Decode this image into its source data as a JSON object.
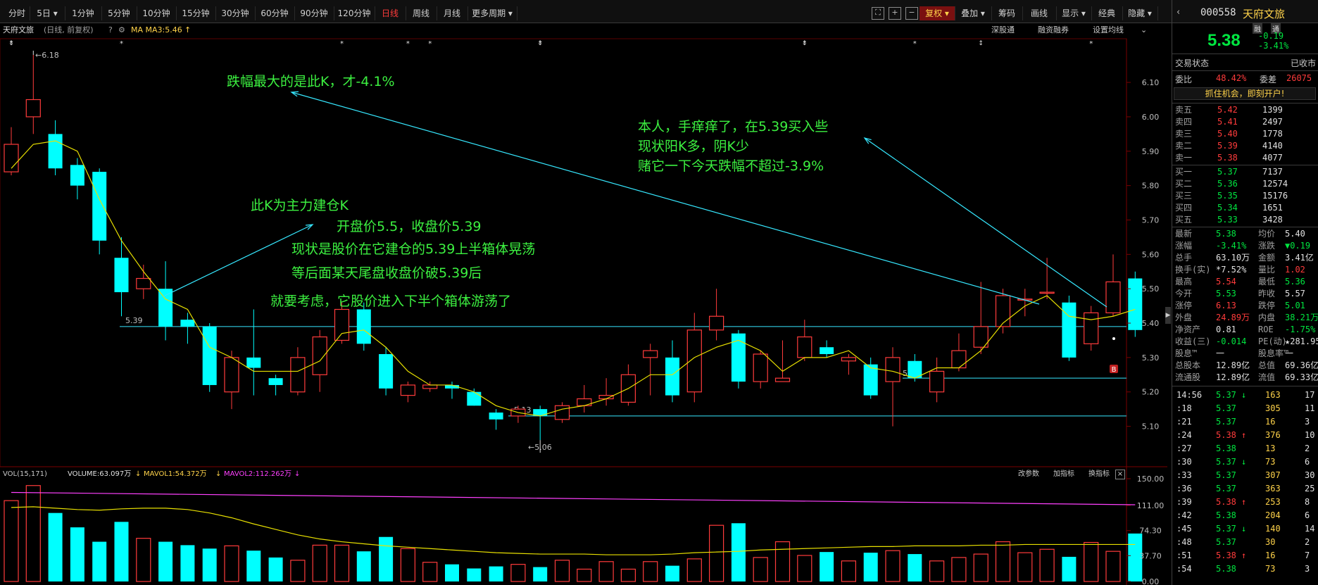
{
  "toolbar": {
    "periods": [
      "分时",
      "5日",
      "1分钟",
      "5分钟",
      "10分钟",
      "15分钟",
      "30分钟",
      "60分钟",
      "90分钟",
      "120分钟",
      "日线",
      "周线",
      "月线",
      "更多周期"
    ],
    "active_period": "日线",
    "right_buttons": [
      "复权",
      "叠加",
      "筹码",
      "画线",
      "显示",
      "经典",
      "隐藏"
    ]
  },
  "subbar": {
    "stock_name": "天府文旅",
    "mode": "(日线, 前复权)",
    "ma_label": "MA  MA3:5.46",
    "links": [
      "深股通",
      "融资融券",
      "设置均线"
    ]
  },
  "annotations": {
    "a1": "跌幅最大的是此K，才-4.1%",
    "a2": "本人，手痒痒了，在5.39买入些",
    "a3": "现状阳K多，阴K少",
    "a4": "赌它一下今天跌幅不超过-3.9%",
    "a5": "此K为主力建仓K",
    "a6": "开盘价5.5，收盘价5.39",
    "a7": "现状是股价在它建仓的5.39上半箱体晃荡",
    "a8": "等后面某天尾盘收盘价破5.39后",
    "a9": "就要考虑，它股价进入下半个箱体游荡了"
  },
  "price_labels": {
    "high": "6.18",
    "low": "5.06",
    "line539": "5.39",
    "line513": "5.13",
    "line524": "5.24"
  },
  "price_axis": [
    "6.10",
    "6.00",
    "5.90",
    "5.80",
    "5.70",
    "5.60",
    "5.50",
    "5.40",
    "5.30",
    "5.20",
    "5.10"
  ],
  "vol": {
    "header_prefix": "VOL(15,171)",
    "volume": "VOLUME:63.097万",
    "mavol1": "MAVOL1:54.372万",
    "mavol2": "MAVOL2:112.262万",
    "links": [
      "改参数",
      "加指标",
      "换指标"
    ],
    "axis": [
      "150.00",
      "111.00",
      "74.30",
      "37.70",
      "0.00"
    ]
  },
  "chart_data": {
    "type": "candlestick",
    "candles": [
      {
        "o": 5.84,
        "c": 5.92,
        "h": 5.97,
        "l": 5.83
      },
      {
        "o": 6.0,
        "c": 6.05,
        "h": 6.18,
        "l": 5.95
      },
      {
        "o": 5.95,
        "c": 5.85,
        "h": 5.99,
        "l": 5.83
      },
      {
        "o": 5.86,
        "c": 5.8,
        "h": 5.88,
        "l": 5.76
      },
      {
        "o": 5.84,
        "c": 5.64,
        "h": 5.85,
        "l": 5.6
      },
      {
        "o": 5.59,
        "c": 5.49,
        "h": 5.65,
        "l": 5.42
      },
      {
        "o": 5.5,
        "c": 5.53,
        "h": 5.57,
        "l": 5.47
      },
      {
        "o": 5.5,
        "c": 5.39,
        "h": 5.58,
        "l": 5.35
      },
      {
        "o": 5.41,
        "c": 5.39,
        "h": 5.43,
        "l": 5.34
      },
      {
        "o": 5.39,
        "c": 5.22,
        "h": 5.4,
        "l": 5.2
      },
      {
        "o": 5.2,
        "c": 5.3,
        "h": 5.32,
        "l": 5.15
      },
      {
        "o": 5.3,
        "c": 5.27,
        "h": 5.44,
        "l": 5.19
      },
      {
        "o": 5.24,
        "c": 5.22,
        "h": 5.25,
        "l": 5.19
      },
      {
        "o": 5.2,
        "c": 5.3,
        "h": 5.33,
        "l": 5.19
      },
      {
        "o": 5.25,
        "c": 5.36,
        "h": 5.38,
        "l": 5.2
      },
      {
        "o": 5.35,
        "c": 5.44,
        "h": 5.46,
        "l": 5.34
      },
      {
        "o": 5.44,
        "c": 5.34,
        "h": 5.46,
        "l": 5.32
      },
      {
        "o": 5.31,
        "c": 5.21,
        "h": 5.33,
        "l": 5.19
      },
      {
        "o": 5.19,
        "c": 5.22,
        "h": 5.23,
        "l": 5.17
      },
      {
        "o": 5.21,
        "c": 5.22,
        "h": 5.23,
        "l": 5.2
      },
      {
        "o": 5.22,
        "c": 5.21,
        "h": 5.23,
        "l": 5.18
      },
      {
        "o": 5.2,
        "c": 5.16,
        "h": 5.21,
        "l": 5.16
      },
      {
        "o": 5.14,
        "c": 5.12,
        "h": 5.15,
        "l": 5.09
      },
      {
        "o": 5.13,
        "c": 5.15,
        "h": 5.16,
        "l": 5.11
      },
      {
        "o": 5.15,
        "c": 5.13,
        "h": 5.16,
        "l": 5.06
      },
      {
        "o": 5.12,
        "c": 5.16,
        "h": 5.17,
        "l": 5.11
      },
      {
        "o": 5.16,
        "c": 5.18,
        "h": 5.22,
        "l": 5.14
      },
      {
        "o": 5.18,
        "c": 5.19,
        "h": 5.24,
        "l": 5.16
      },
      {
        "o": 5.17,
        "c": 5.25,
        "h": 5.28,
        "l": 5.16
      },
      {
        "o": 5.3,
        "c": 5.32,
        "h": 5.34,
        "l": 5.19
      },
      {
        "o": 5.3,
        "c": 5.19,
        "h": 5.35,
        "l": 5.17
      },
      {
        "o": 5.2,
        "c": 5.38,
        "h": 5.43,
        "l": 5.17
      },
      {
        "o": 5.38,
        "c": 5.42,
        "h": 5.5,
        "l": 5.35
      },
      {
        "o": 5.37,
        "c": 5.23,
        "h": 5.38,
        "l": 5.21
      },
      {
        "o": 5.23,
        "c": 5.31,
        "h": 5.32,
        "l": 5.21
      },
      {
        "o": 5.23,
        "c": 5.24,
        "h": 5.35,
        "l": 5.23
      },
      {
        "o": 5.3,
        "c": 5.36,
        "h": 5.41,
        "l": 5.29
      },
      {
        "o": 5.33,
        "c": 5.31,
        "h": 5.35,
        "l": 5.3
      },
      {
        "o": 5.29,
        "c": 5.3,
        "h": 5.31,
        "l": 5.25
      },
      {
        "o": 5.28,
        "c": 5.19,
        "h": 5.3,
        "l": 5.18
      },
      {
        "o": 5.23,
        "c": 5.3,
        "h": 5.33,
        "l": 5.1
      },
      {
        "o": 5.29,
        "c": 5.24,
        "h": 5.31,
        "l": 5.23
      },
      {
        "o": 5.2,
        "c": 5.26,
        "h": 5.3,
        "l": 5.17
      },
      {
        "o": 5.27,
        "c": 5.32,
        "h": 5.37,
        "l": 5.26
      },
      {
        "o": 5.33,
        "c": 5.39,
        "h": 5.52,
        "l": 5.31
      },
      {
        "o": 5.39,
        "c": 5.48,
        "h": 5.5,
        "l": 5.37
      },
      {
        "o": 5.47,
        "c": 5.47,
        "h": 5.5,
        "l": 5.42
      },
      {
        "o": 5.49,
        "c": 5.49,
        "h": 5.59,
        "l": 5.47
      },
      {
        "o": 5.46,
        "c": 5.3,
        "h": 5.48,
        "l": 5.29
      },
      {
        "o": 5.34,
        "c": 5.43,
        "h": 5.45,
        "l": 5.32
      },
      {
        "o": 5.43,
        "c": 5.52,
        "h": 5.6,
        "l": 5.42
      },
      {
        "o": 5.53,
        "c": 5.38,
        "h": 5.55,
        "l": 5.36
      }
    ],
    "ma3": [
      5.85,
      5.92,
      5.93,
      5.9,
      5.76,
      5.64,
      5.55,
      5.47,
      5.44,
      5.33,
      5.3,
      5.26,
      5.26,
      5.26,
      5.29,
      5.37,
      5.38,
      5.33,
      5.26,
      5.22,
      5.22,
      5.2,
      5.16,
      5.14,
      5.13,
      5.15,
      5.16,
      5.18,
      5.21,
      5.25,
      5.25,
      5.3,
      5.33,
      5.35,
      5.32,
      5.26,
      5.3,
      5.3,
      5.32,
      5.27,
      5.26,
      5.24,
      5.27,
      5.27,
      5.32,
      5.4,
      5.45,
      5.48,
      5.42,
      5.41,
      5.42,
      5.44
    ],
    "volume": [
      118,
      140,
      100,
      79,
      58,
      87,
      63,
      58,
      53,
      48,
      52,
      45,
      35,
      31,
      53,
      53,
      44,
      65,
      48,
      28,
      25,
      19,
      22,
      25,
      21,
      31,
      18,
      29,
      18,
      29,
      23,
      33,
      82,
      85,
      35,
      58,
      38,
      43,
      30,
      42,
      45,
      40,
      30,
      35,
      40,
      58,
      42,
      47,
      36,
      57,
      44,
      70
    ],
    "mavol1": [
      108,
      109,
      107,
      105,
      104,
      106,
      107,
      107,
      105,
      100,
      93,
      84,
      76,
      68,
      62,
      58,
      55,
      52,
      50,
      48,
      46,
      44,
      42,
      41,
      40,
      40,
      40,
      39,
      39,
      39,
      40,
      42,
      43,
      44,
      46,
      47,
      48,
      49,
      50,
      51,
      51,
      52,
      52,
      52,
      53,
      53,
      54,
      54,
      54,
      54,
      54,
      54
    ],
    "mavol2_range": [
      130,
      112
    ],
    "yrange": [
      5.05,
      6.18
    ],
    "vol_range": [
      0,
      150
    ]
  },
  "quote": {
    "code": "000558",
    "name": "天府文旅",
    "badges": [
      "融",
      "通"
    ],
    "price": "5.38",
    "change": "-0.19",
    "change_pct": "-3.41%",
    "status_label": "交易状态",
    "status_value": "已收市",
    "weibi_label": "委比",
    "weibi": "48.42%",
    "weicha_label": "委差",
    "weicha": "26075",
    "promo": "抓住机会，即刻开户!",
    "asks": [
      [
        "卖五",
        "5.42",
        "1399"
      ],
      [
        "卖四",
        "5.41",
        "2497"
      ],
      [
        "卖三",
        "5.40",
        "1778"
      ],
      [
        "卖二",
        "5.39",
        "4140"
      ],
      [
        "卖一",
        "5.38",
        "4077"
      ]
    ],
    "bids": [
      [
        "买一",
        "5.37",
        "7137"
      ],
      [
        "买二",
        "5.36",
        "12574"
      ],
      [
        "买三",
        "5.35",
        "15176"
      ],
      [
        "买四",
        "5.34",
        "1651"
      ],
      [
        "买五",
        "5.33",
        "3428"
      ]
    ],
    "stats": [
      [
        "最新",
        "5.38",
        "均价",
        "5.40"
      ],
      [
        "涨幅",
        "-3.41%",
        "涨跌",
        "▼0.19"
      ],
      [
        "总手",
        "63.10万",
        "金额",
        "3.41亿"
      ],
      [
        "换手(实)",
        "*7.52%",
        "量比",
        "1.02"
      ],
      [
        "最高",
        "5.54",
        "最低",
        "5.36"
      ],
      [
        "今开",
        "5.53",
        "昨收",
        "5.57"
      ],
      [
        "涨停",
        "6.13",
        "跌停",
        "5.01"
      ],
      [
        "外盘",
        "24.89万",
        "内盘",
        "38.21万"
      ],
      [
        "净资产",
        "0.81",
        "ROE",
        "-1.75%"
      ],
      [
        "收益(三)",
        "-0.014",
        "PE(动)",
        "★281.95"
      ],
      [
        "股息™",
        "一",
        "股息率™",
        "一"
      ],
      [
        "总股本",
        "12.89亿",
        "总值",
        "69.36亿"
      ],
      [
        "流通股",
        "12.89亿",
        "流值",
        "69.33亿"
      ]
    ],
    "ticks": [
      [
        "14:56",
        "5.37",
        "↓",
        "163",
        "17"
      ],
      [
        ":18",
        "5.37",
        "",
        "305",
        "11"
      ],
      [
        ":21",
        "5.37",
        "",
        "16",
        "3"
      ],
      [
        ":24",
        "5.38",
        "↑",
        "376",
        "10"
      ],
      [
        ":27",
        "5.38",
        "",
        "13",
        "2"
      ],
      [
        ":30",
        "5.37",
        "↓",
        "73",
        "6"
      ],
      [
        ":33",
        "5.37",
        "",
        "307",
        "30"
      ],
      [
        ":36",
        "5.37",
        "",
        "363",
        "25"
      ],
      [
        ":39",
        "5.38",
        "↑",
        "253",
        "8"
      ],
      [
        ":42",
        "5.38",
        "",
        "204",
        "6"
      ],
      [
        ":45",
        "5.37",
        "↓",
        "140",
        "14"
      ],
      [
        ":48",
        "5.37",
        "",
        "30",
        "2"
      ],
      [
        ":51",
        "5.38",
        "↑",
        "16",
        "7"
      ],
      [
        ":54",
        "5.38",
        "",
        "73",
        "3"
      ]
    ]
  }
}
